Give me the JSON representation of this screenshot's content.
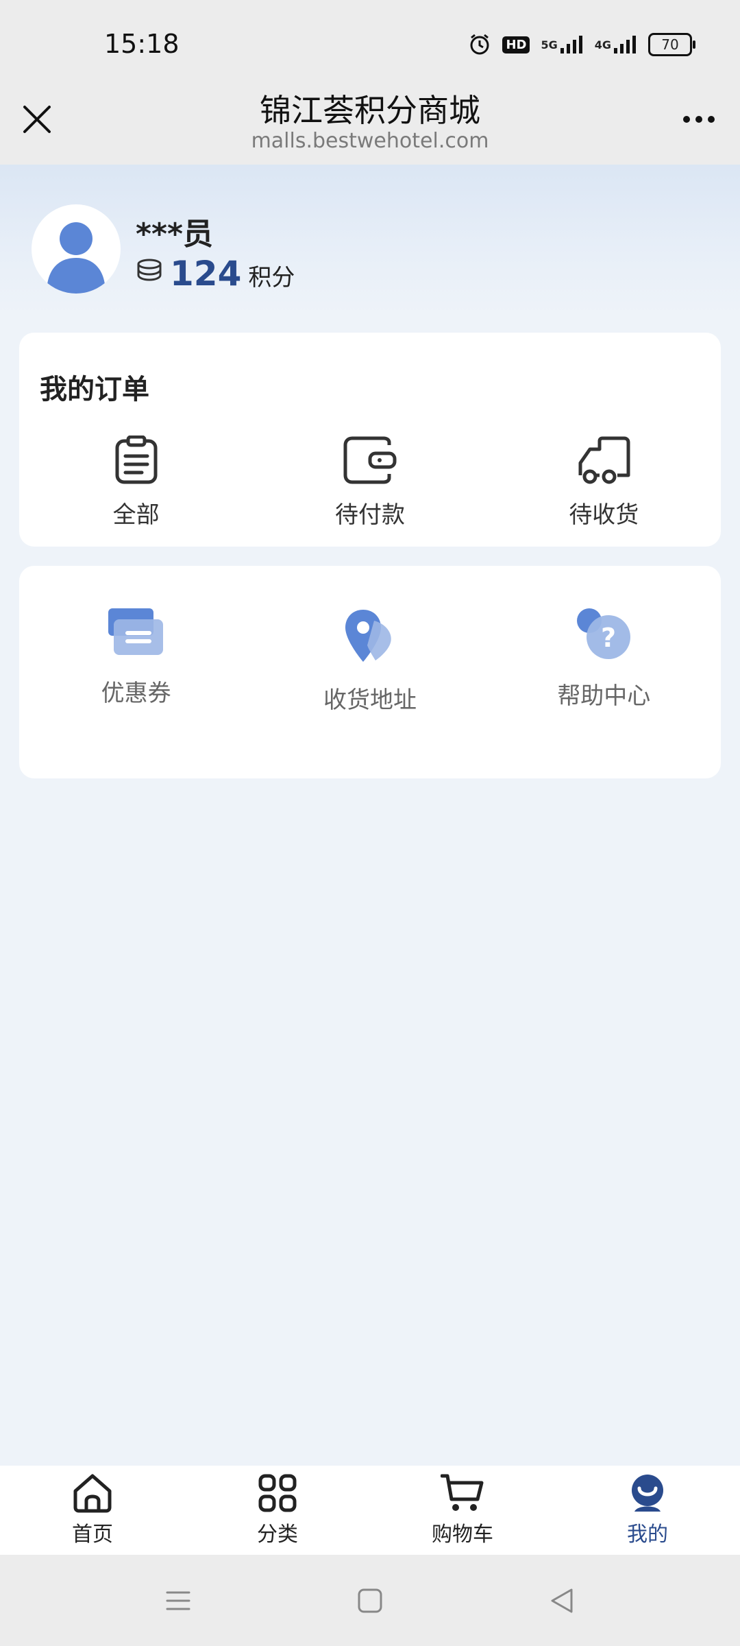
{
  "status": {
    "time": "15:18",
    "network_5g": "5G",
    "network_4g": "4G",
    "battery": "70",
    "hd_badge": "HD"
  },
  "nav": {
    "title": "锦江荟积分商城",
    "subtitle": "malls.bestwehotel.com"
  },
  "user": {
    "name": "***员",
    "points": "124",
    "points_unit": "积分"
  },
  "orders": {
    "title": "我的订单",
    "items": [
      {
        "label": "全部"
      },
      {
        "label": "待付款"
      },
      {
        "label": "待收货"
      }
    ]
  },
  "tools": {
    "items": [
      {
        "label": "优惠券"
      },
      {
        "label": "收货地址"
      },
      {
        "label": "帮助中心"
      }
    ]
  },
  "tabbar": {
    "items": [
      {
        "label": "首页"
      },
      {
        "label": "分类"
      },
      {
        "label": "购物车"
      },
      {
        "label": "我的"
      }
    ]
  },
  "colors": {
    "accent": "#2a4b8d",
    "icon_blue": "#5b86d6"
  }
}
